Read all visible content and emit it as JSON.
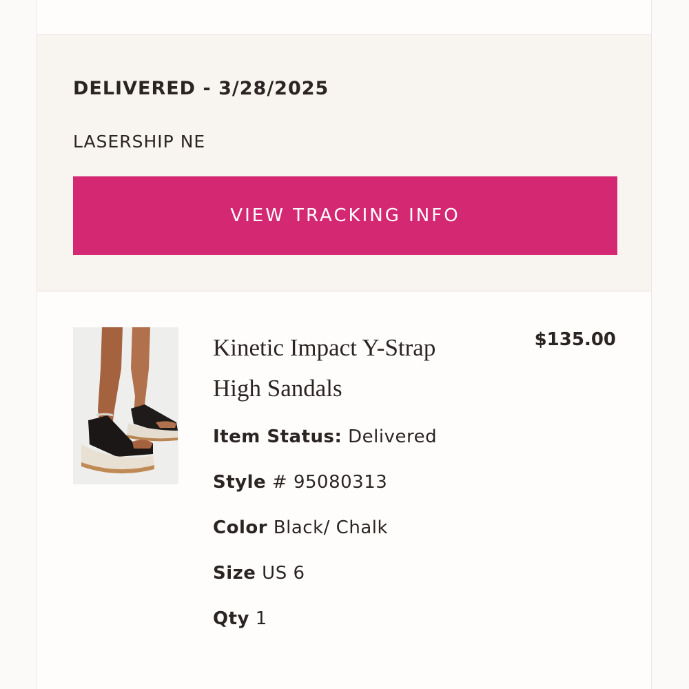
{
  "shipment": {
    "status_title": "DELIVERED - 3/28/2025",
    "carrier": "LASERSHIP NE",
    "tracking_button_label": "VIEW TRACKING INFO",
    "accent_color": "#d42873"
  },
  "item": {
    "name": "Kinetic Impact Y-Strap High Sandals",
    "price": "$135.00",
    "image_alt": "product-photo-sandals",
    "attributes": {
      "status_label": "Item Status:",
      "status_value": "Delivered",
      "style_label": "Style",
      "style_value": "# 95080313",
      "color_label": "Color",
      "color_value": "Black/ Chalk",
      "size_label": "Size",
      "size_value": "US 6",
      "qty_label": "Qty",
      "qty_value": "1"
    }
  }
}
